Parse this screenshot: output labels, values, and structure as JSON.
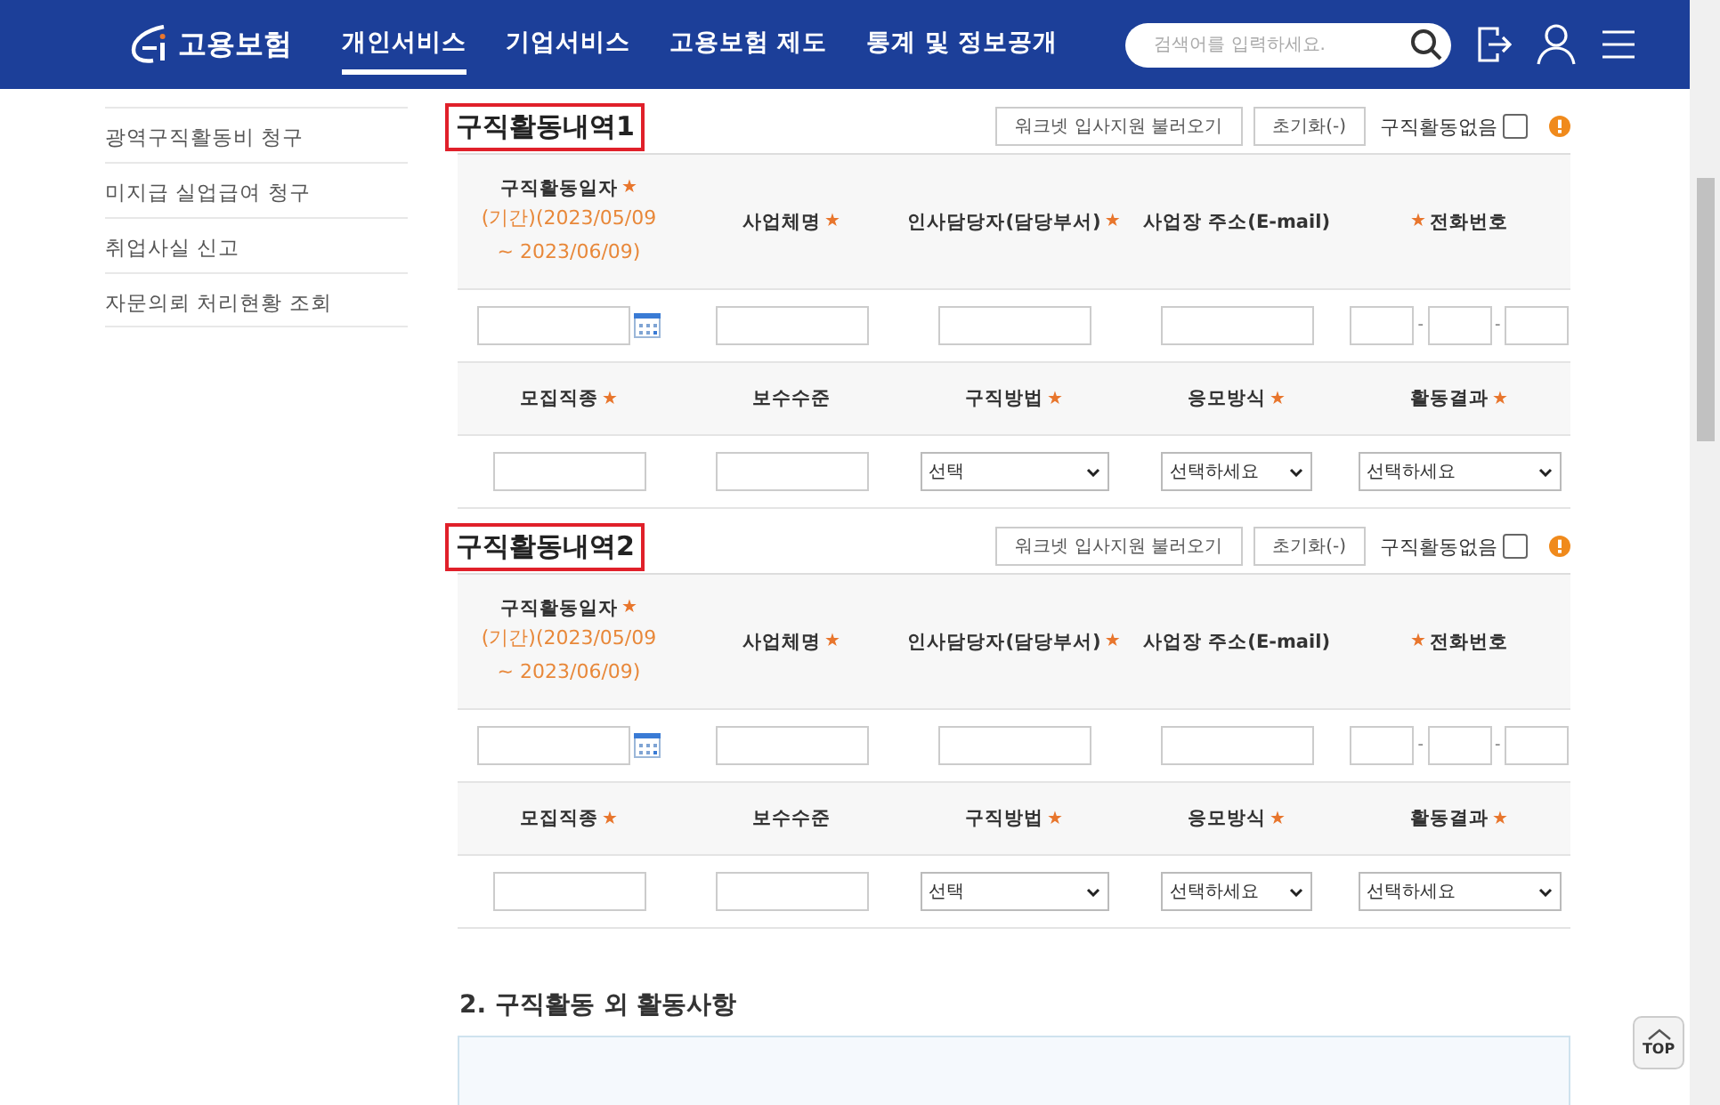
{
  "header": {
    "logo": "고용보험",
    "nav": [
      {
        "label": "개인서비스",
        "selected": true
      },
      {
        "label": "기업서비스",
        "selected": false
      },
      {
        "label": "고용보험 제도",
        "selected": false
      },
      {
        "label": "통계 및 정보공개",
        "selected": false
      }
    ],
    "search": {
      "placeholder": "검색어를 입력하세요."
    }
  },
  "sidebar": {
    "items": [
      "광역구직활동비 청구",
      "미지급 실업급여 청구",
      "취업사실 신고",
      "자문의뢰 처리현황 조회"
    ]
  },
  "sections": [
    {
      "title": "구직활동내역1",
      "buttons": [
        "워크넷 입사지원 불러오기",
        "초기화(-)"
      ],
      "no_activity": {
        "label": "구직활동없음",
        "checked": false
      },
      "rows": [
        {
          "kind": "header",
          "cells": [
            {
              "label": "구직활동일자",
              "star": "★",
              "period": [
                "(기간)(2023/05/09",
                "~ 2023/06/09)"
              ]
            },
            {
              "label": "사업체명",
              "star": "★"
            },
            {
              "label": "인사담당자(담당부서)",
              "star": "★"
            },
            {
              "label": "사업장 주소(E-mail)"
            },
            {
              "star_before": "★",
              "label": "전화번호"
            }
          ]
        },
        {
          "kind": "inputs",
          "cells": [
            {
              "kind": "date"
            },
            {
              "kind": "text"
            },
            {
              "kind": "text"
            },
            {
              "kind": "text"
            },
            {
              "kind": "phone",
              "separators": [
                "-",
                "-"
              ]
            }
          ]
        },
        {
          "kind": "header",
          "cells": [
            {
              "label": "모집직종",
              "star": "★"
            },
            {
              "label": "보수수준"
            },
            {
              "label": "구직방법",
              "star": "★"
            },
            {
              "label": "응모방식",
              "star": "★"
            },
            {
              "label": "활동결과",
              "star": "★"
            }
          ]
        },
        {
          "kind": "inputs",
          "cells": [
            {
              "kind": "text"
            },
            {
              "kind": "text"
            },
            {
              "kind": "select",
              "value": "선택"
            },
            {
              "kind": "select",
              "value": "선택하세요"
            },
            {
              "kind": "select",
              "value": "선택하세요"
            }
          ]
        }
      ]
    },
    {
      "title": "구직활동내역2",
      "buttons": [
        "워크넷 입사지원 불러오기",
        "초기화(-)"
      ],
      "no_activity": {
        "label": "구직활동없음",
        "checked": false
      },
      "rows": [
        {
          "kind": "header",
          "cells": [
            {
              "label": "구직활동일자",
              "star": "★",
              "period": [
                "(기간)(2023/05/09",
                "~ 2023/06/09)"
              ]
            },
            {
              "label": "사업체명",
              "star": "★"
            },
            {
              "label": "인사담당자(담당부서)",
              "star": "★"
            },
            {
              "label": "사업장 주소(E-mail)"
            },
            {
              "star_before": "★",
              "label": "전화번호"
            }
          ]
        },
        {
          "kind": "inputs",
          "cells": [
            {
              "kind": "date"
            },
            {
              "kind": "text"
            },
            {
              "kind": "text"
            },
            {
              "kind": "text"
            },
            {
              "kind": "phone",
              "separators": [
                "-",
                "-"
              ]
            }
          ]
        },
        {
          "kind": "header",
          "cells": [
            {
              "label": "모집직종",
              "star": "★"
            },
            {
              "label": "보수수준"
            },
            {
              "label": "구직방법",
              "star": "★"
            },
            {
              "label": "응모방식",
              "star": "★"
            },
            {
              "label": "활동결과",
              "star": "★"
            }
          ]
        },
        {
          "kind": "inputs",
          "cells": [
            {
              "kind": "text"
            },
            {
              "kind": "text"
            },
            {
              "kind": "select",
              "value": "선택"
            },
            {
              "kind": "select",
              "value": "선택하세요"
            },
            {
              "kind": "select",
              "value": "선택하세요"
            }
          ]
        }
      ]
    }
  ],
  "next_section": {
    "title": "2. 구직활동 외 활동사항"
  },
  "top_button": "TOP"
}
